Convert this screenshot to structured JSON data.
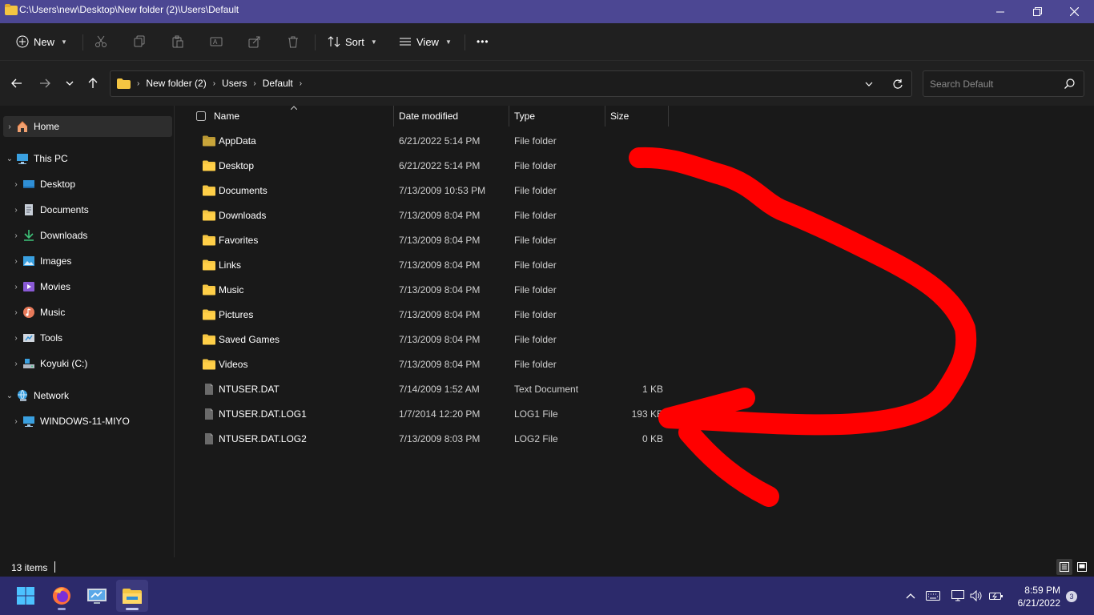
{
  "window": {
    "title": "C:\\Users\\new\\Desktop\\New folder (2)\\Users\\Default"
  },
  "toolbar": {
    "new_label": "New",
    "sort_label": "Sort",
    "view_label": "View",
    "more_label": "•••"
  },
  "address": {
    "crumbs": [
      "New folder (2)",
      "Users",
      "Default"
    ]
  },
  "search": {
    "placeholder": "Search Default"
  },
  "sidebar": {
    "items": [
      {
        "label": "Home",
        "icon": "home-icon"
      },
      {
        "label": "This PC",
        "icon": "computer-icon"
      },
      {
        "label": "Desktop",
        "icon": "desktop-icon"
      },
      {
        "label": "Documents",
        "icon": "documents-icon"
      },
      {
        "label": "Downloads",
        "icon": "downloads-icon"
      },
      {
        "label": "Images",
        "icon": "images-icon"
      },
      {
        "label": "Movies",
        "icon": "movies-icon"
      },
      {
        "label": "Music",
        "icon": "music-icon"
      },
      {
        "label": "Tools",
        "icon": "tools-icon"
      },
      {
        "label": "Koyuki (C:)",
        "icon": "drive-icon"
      },
      {
        "label": "Network",
        "icon": "network-icon"
      },
      {
        "label": "WINDOWS-11-MIYO",
        "icon": "computer-icon"
      }
    ]
  },
  "columns": {
    "name": "Name",
    "date": "Date modified",
    "type": "Type",
    "size": "Size"
  },
  "files": [
    {
      "name": "AppData",
      "date": "6/21/2022 5:14 PM",
      "type": "File folder",
      "size": "",
      "kind": "folder"
    },
    {
      "name": "Desktop",
      "date": "6/21/2022 5:14 PM",
      "type": "File folder",
      "size": "",
      "kind": "folder"
    },
    {
      "name": "Documents",
      "date": "7/13/2009 10:53 PM",
      "type": "File folder",
      "size": "",
      "kind": "folder"
    },
    {
      "name": "Downloads",
      "date": "7/13/2009 8:04 PM",
      "type": "File folder",
      "size": "",
      "kind": "folder"
    },
    {
      "name": "Favorites",
      "date": "7/13/2009 8:04 PM",
      "type": "File folder",
      "size": "",
      "kind": "folder"
    },
    {
      "name": "Links",
      "date": "7/13/2009 8:04 PM",
      "type": "File folder",
      "size": "",
      "kind": "folder"
    },
    {
      "name": "Music",
      "date": "7/13/2009 8:04 PM",
      "type": "File folder",
      "size": "",
      "kind": "folder"
    },
    {
      "name": "Pictures",
      "date": "7/13/2009 8:04 PM",
      "type": "File folder",
      "size": "",
      "kind": "folder"
    },
    {
      "name": "Saved Games",
      "date": "7/13/2009 8:04 PM",
      "type": "File folder",
      "size": "",
      "kind": "folder"
    },
    {
      "name": "Videos",
      "date": "7/13/2009 8:04 PM",
      "type": "File folder",
      "size": "",
      "kind": "folder"
    },
    {
      "name": "NTUSER.DAT",
      "date": "7/14/2009 1:52 AM",
      "type": "Text Document",
      "size": "1 KB",
      "kind": "file"
    },
    {
      "name": "NTUSER.DAT.LOG1",
      "date": "1/7/2014 12:20 PM",
      "type": "LOG1 File",
      "size": "193 KB",
      "kind": "file"
    },
    {
      "name": "NTUSER.DAT.LOG2",
      "date": "7/13/2009 8:03 PM",
      "type": "LOG2 File",
      "size": "0 KB",
      "kind": "file"
    }
  ],
  "status": {
    "item_count": "13 items"
  },
  "taskbar": {
    "time": "8:59 PM",
    "date": "6/21/2022",
    "notification_count": "3"
  },
  "colors": {
    "titlebar": "#4c4793",
    "taskbar": "#2c2a6b",
    "folder": "#f4c542",
    "annotation": "#ff0000"
  }
}
